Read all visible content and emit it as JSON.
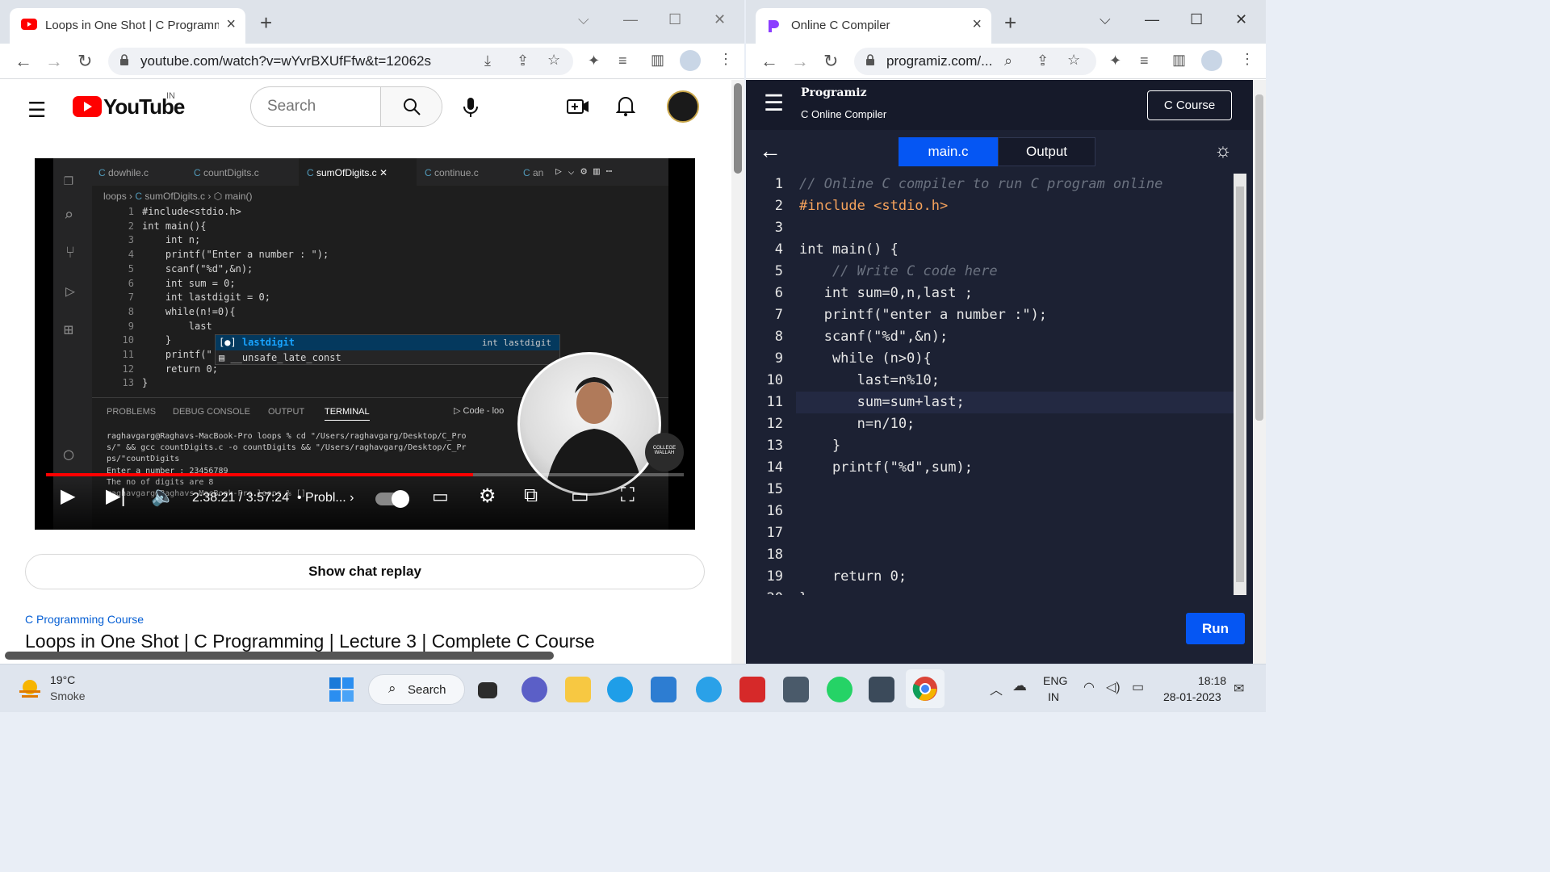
{
  "left_window": {
    "tab_title": "Loops in One Shot | C Programm",
    "url": "youtube.com/watch?v=wYvrBXUfFfw&t=12062s",
    "youtube": {
      "logo_text": "YouTube",
      "country": "IN",
      "search_placeholder": "Search",
      "player": {
        "time": "2:38:21 / 3:57:24",
        "chapter": "Probl...",
        "progress_fraction": 0.67
      },
      "vscode": {
        "tabs": [
          "dowhile.c",
          "countDigits.c",
          "sumOfDigits.c",
          "continue.c",
          "an"
        ],
        "breadcrumb": [
          "loops",
          "sumOfDigits.c",
          "main()"
        ],
        "lines": [
          {
            "n": "1",
            "t": "#include<stdio.h>"
          },
          {
            "n": "2",
            "t": "int main(){"
          },
          {
            "n": "3",
            "t": "    int n;"
          },
          {
            "n": "4",
            "t": "    printf(\"Enter a number : \");"
          },
          {
            "n": "5",
            "t": "    scanf(\"%d\",&n);"
          },
          {
            "n": "6",
            "t": "    int sum = 0;"
          },
          {
            "n": "7",
            "t": "    int lastdigit = 0;"
          },
          {
            "n": "8",
            "t": "    while(n!=0){"
          },
          {
            "n": "9",
            "t": "        last"
          },
          {
            "n": "10",
            "t": "    }"
          },
          {
            "n": "11",
            "t": "    printf(\""
          },
          {
            "n": "12",
            "t": "    return 0;"
          },
          {
            "n": "13",
            "t": "}"
          }
        ],
        "suggest_main": "lastdigit",
        "suggest_type": "int lastdigit",
        "suggest_second": "__unsafe_late_const",
        "panel_tabs": [
          "PROBLEMS",
          "DEBUG CONSOLE",
          "OUTPUT",
          "TERMINAL"
        ],
        "panel_extra": "Code - loo",
        "terminal": [
          "raghavgarg@Raghavs-MacBook-Pro loops % cd \"/Users/raghavgarg/Desktop/C_Pro",
          "s/\" && gcc countDigits.c -o countDigits && \"/Users/raghavgarg/Desktop/C_Pr",
          "ps/\"countDigits",
          "Enter a number : 23456789",
          "The no of digits are 8",
          "raghavgarg@Raghavs-MacBook-Pro loops % []"
        ],
        "watermark": "COLLEGE WALLAH"
      },
      "chat_replay": "Show chat replay",
      "course_link": "C Programming Course",
      "video_title": "Loops in One Shot | C Programming | Lecture 3 | Complete C Course"
    }
  },
  "right_window": {
    "tab_title": "Online C Compiler",
    "url": "programiz.com/...",
    "programiz": {
      "brand": "Programiz",
      "subtitle": "C Online Compiler",
      "course_button": "C Course",
      "tab_main": "main.c",
      "tab_output": "Output",
      "run_button": "Run",
      "code": [
        {
          "n": "1",
          "t": "// Online C compiler to run C program online"
        },
        {
          "n": "2",
          "t": "#include <stdio.h>"
        },
        {
          "n": "3",
          "t": ""
        },
        {
          "n": "4",
          "t": "int main() {"
        },
        {
          "n": "5",
          "t": "    // Write C code here"
        },
        {
          "n": "6",
          "t": "   int sum=0,n,last ;"
        },
        {
          "n": "7",
          "t": "   printf(\"enter a number :\");"
        },
        {
          "n": "8",
          "t": "   scanf(\"%d\",&n);"
        },
        {
          "n": "9",
          "t": "    while (n>0){"
        },
        {
          "n": "10",
          "t": "       last=n%10;"
        },
        {
          "n": "11",
          "t": "       sum=sum+last;"
        },
        {
          "n": "12",
          "t": "       n=n/10;"
        },
        {
          "n": "13",
          "t": "    }"
        },
        {
          "n": "14",
          "t": "    printf(\"%d\",sum);"
        },
        {
          "n": "15",
          "t": ""
        },
        {
          "n": "16",
          "t": ""
        },
        {
          "n": "17",
          "t": ""
        },
        {
          "n": "18",
          "t": ""
        },
        {
          "n": "19",
          "t": "    return 0;"
        },
        {
          "n": "20",
          "t": "}"
        }
      ]
    }
  },
  "taskbar": {
    "weather_temp": "19°C",
    "weather_desc": "Smoke",
    "search_label": "Search",
    "lang_top": "ENG",
    "lang_bottom": "IN",
    "time": "18:18",
    "date": "28-01-2023"
  },
  "colors": {
    "youtube_red": "#ff0000",
    "programiz_blue": "#0556f3",
    "run_blue": "#0556f3",
    "editor_bg": "#1c2133",
    "header_bg": "#161a2a"
  }
}
